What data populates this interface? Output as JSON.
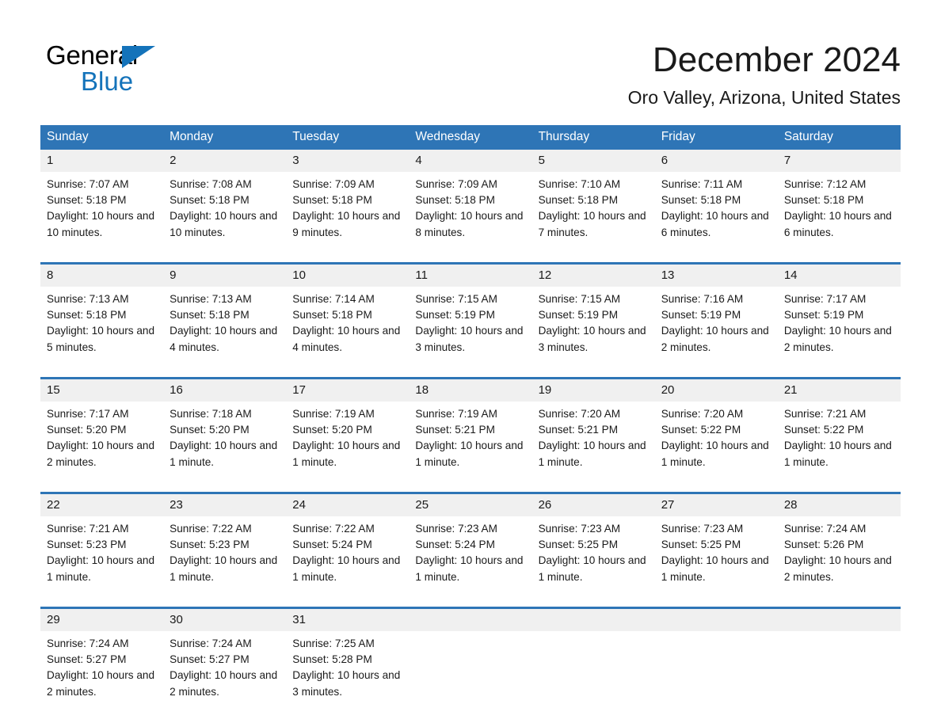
{
  "brand": {
    "name_part1": "General",
    "name_part2": "Blue",
    "triangle_color": "#1473BA"
  },
  "header": {
    "title": "December 2024",
    "location": "Oro Valley, Arizona, United States"
  },
  "theme": {
    "header_blue": "#2E75B6",
    "date_band_gray": "#F0F0F0",
    "text_color": "#1a1a1a"
  },
  "weekday_headers": [
    "Sunday",
    "Monday",
    "Tuesday",
    "Wednesday",
    "Thursday",
    "Friday",
    "Saturday"
  ],
  "weeks": [
    {
      "days": [
        {
          "date": "1",
          "sunrise": "Sunrise: 7:07 AM",
          "sunset": "Sunset: 5:18 PM",
          "daylight": "Daylight: 10 hours and 10 minutes."
        },
        {
          "date": "2",
          "sunrise": "Sunrise: 7:08 AM",
          "sunset": "Sunset: 5:18 PM",
          "daylight": "Daylight: 10 hours and 10 minutes."
        },
        {
          "date": "3",
          "sunrise": "Sunrise: 7:09 AM",
          "sunset": "Sunset: 5:18 PM",
          "daylight": "Daylight: 10 hours and 9 minutes."
        },
        {
          "date": "4",
          "sunrise": "Sunrise: 7:09 AM",
          "sunset": "Sunset: 5:18 PM",
          "daylight": "Daylight: 10 hours and 8 minutes."
        },
        {
          "date": "5",
          "sunrise": "Sunrise: 7:10 AM",
          "sunset": "Sunset: 5:18 PM",
          "daylight": "Daylight: 10 hours and 7 minutes."
        },
        {
          "date": "6",
          "sunrise": "Sunrise: 7:11 AM",
          "sunset": "Sunset: 5:18 PM",
          "daylight": "Daylight: 10 hours and 6 minutes."
        },
        {
          "date": "7",
          "sunrise": "Sunrise: 7:12 AM",
          "sunset": "Sunset: 5:18 PM",
          "daylight": "Daylight: 10 hours and 6 minutes."
        }
      ]
    },
    {
      "days": [
        {
          "date": "8",
          "sunrise": "Sunrise: 7:13 AM",
          "sunset": "Sunset: 5:18 PM",
          "daylight": "Daylight: 10 hours and 5 minutes."
        },
        {
          "date": "9",
          "sunrise": "Sunrise: 7:13 AM",
          "sunset": "Sunset: 5:18 PM",
          "daylight": "Daylight: 10 hours and 4 minutes."
        },
        {
          "date": "10",
          "sunrise": "Sunrise: 7:14 AM",
          "sunset": "Sunset: 5:18 PM",
          "daylight": "Daylight: 10 hours and 4 minutes."
        },
        {
          "date": "11",
          "sunrise": "Sunrise: 7:15 AM",
          "sunset": "Sunset: 5:19 PM",
          "daylight": "Daylight: 10 hours and 3 minutes."
        },
        {
          "date": "12",
          "sunrise": "Sunrise: 7:15 AM",
          "sunset": "Sunset: 5:19 PM",
          "daylight": "Daylight: 10 hours and 3 minutes."
        },
        {
          "date": "13",
          "sunrise": "Sunrise: 7:16 AM",
          "sunset": "Sunset: 5:19 PM",
          "daylight": "Daylight: 10 hours and 2 minutes."
        },
        {
          "date": "14",
          "sunrise": "Sunrise: 7:17 AM",
          "sunset": "Sunset: 5:19 PM",
          "daylight": "Daylight: 10 hours and 2 minutes."
        }
      ]
    },
    {
      "days": [
        {
          "date": "15",
          "sunrise": "Sunrise: 7:17 AM",
          "sunset": "Sunset: 5:20 PM",
          "daylight": "Daylight: 10 hours and 2 minutes."
        },
        {
          "date": "16",
          "sunrise": "Sunrise: 7:18 AM",
          "sunset": "Sunset: 5:20 PM",
          "daylight": "Daylight: 10 hours and 1 minute."
        },
        {
          "date": "17",
          "sunrise": "Sunrise: 7:19 AM",
          "sunset": "Sunset: 5:20 PM",
          "daylight": "Daylight: 10 hours and 1 minute."
        },
        {
          "date": "18",
          "sunrise": "Sunrise: 7:19 AM",
          "sunset": "Sunset: 5:21 PM",
          "daylight": "Daylight: 10 hours and 1 minute."
        },
        {
          "date": "19",
          "sunrise": "Sunrise: 7:20 AM",
          "sunset": "Sunset: 5:21 PM",
          "daylight": "Daylight: 10 hours and 1 minute."
        },
        {
          "date": "20",
          "sunrise": "Sunrise: 7:20 AM",
          "sunset": "Sunset: 5:22 PM",
          "daylight": "Daylight: 10 hours and 1 minute."
        },
        {
          "date": "21",
          "sunrise": "Sunrise: 7:21 AM",
          "sunset": "Sunset: 5:22 PM",
          "daylight": "Daylight: 10 hours and 1 minute."
        }
      ]
    },
    {
      "days": [
        {
          "date": "22",
          "sunrise": "Sunrise: 7:21 AM",
          "sunset": "Sunset: 5:23 PM",
          "daylight": "Daylight: 10 hours and 1 minute."
        },
        {
          "date": "23",
          "sunrise": "Sunrise: 7:22 AM",
          "sunset": "Sunset: 5:23 PM",
          "daylight": "Daylight: 10 hours and 1 minute."
        },
        {
          "date": "24",
          "sunrise": "Sunrise: 7:22 AM",
          "sunset": "Sunset: 5:24 PM",
          "daylight": "Daylight: 10 hours and 1 minute."
        },
        {
          "date": "25",
          "sunrise": "Sunrise: 7:23 AM",
          "sunset": "Sunset: 5:24 PM",
          "daylight": "Daylight: 10 hours and 1 minute."
        },
        {
          "date": "26",
          "sunrise": "Sunrise: 7:23 AM",
          "sunset": "Sunset: 5:25 PM",
          "daylight": "Daylight: 10 hours and 1 minute."
        },
        {
          "date": "27",
          "sunrise": "Sunrise: 7:23 AM",
          "sunset": "Sunset: 5:25 PM",
          "daylight": "Daylight: 10 hours and 1 minute."
        },
        {
          "date": "28",
          "sunrise": "Sunrise: 7:24 AM",
          "sunset": "Sunset: 5:26 PM",
          "daylight": "Daylight: 10 hours and 2 minutes."
        }
      ]
    },
    {
      "days": [
        {
          "date": "29",
          "sunrise": "Sunrise: 7:24 AM",
          "sunset": "Sunset: 5:27 PM",
          "daylight": "Daylight: 10 hours and 2 minutes."
        },
        {
          "date": "30",
          "sunrise": "Sunrise: 7:24 AM",
          "sunset": "Sunset: 5:27 PM",
          "daylight": "Daylight: 10 hours and 2 minutes."
        },
        {
          "date": "31",
          "sunrise": "Sunrise: 7:25 AM",
          "sunset": "Sunset: 5:28 PM",
          "daylight": "Daylight: 10 hours and 3 minutes."
        },
        {
          "date": "",
          "sunrise": "",
          "sunset": "",
          "daylight": ""
        },
        {
          "date": "",
          "sunrise": "",
          "sunset": "",
          "daylight": ""
        },
        {
          "date": "",
          "sunrise": "",
          "sunset": "",
          "daylight": ""
        },
        {
          "date": "",
          "sunrise": "",
          "sunset": "",
          "daylight": ""
        }
      ]
    }
  ]
}
